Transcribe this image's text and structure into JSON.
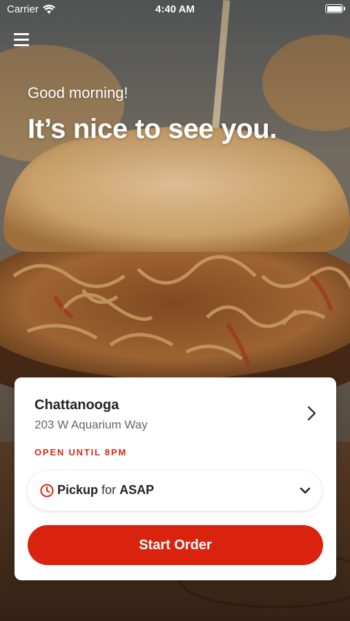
{
  "status_bar": {
    "carrier": "Carrier",
    "time": "4:40 AM",
    "wifi_icon": "wifi-icon",
    "battery_icon": "battery-icon"
  },
  "header": {
    "menu_icon": "hamburger-menu-icon",
    "greeting": "Good morning!",
    "headline": "It’s nice to see you."
  },
  "store_card": {
    "name": "Chattanooga",
    "address": "203 W Aquarium Way",
    "hours": "OPEN UNTIL 8PM",
    "chevron_icon": "chevron-right-icon",
    "pickup": {
      "clock_icon": "clock-icon",
      "mode": "Pickup",
      "connector": "for",
      "time": "ASAP",
      "caret_icon": "chevron-down-icon"
    },
    "start_button_label": "Start Order"
  },
  "colors": {
    "accent": "#d9230f",
    "hours_text": "#d42a10",
    "card_background": "#ffffff"
  }
}
